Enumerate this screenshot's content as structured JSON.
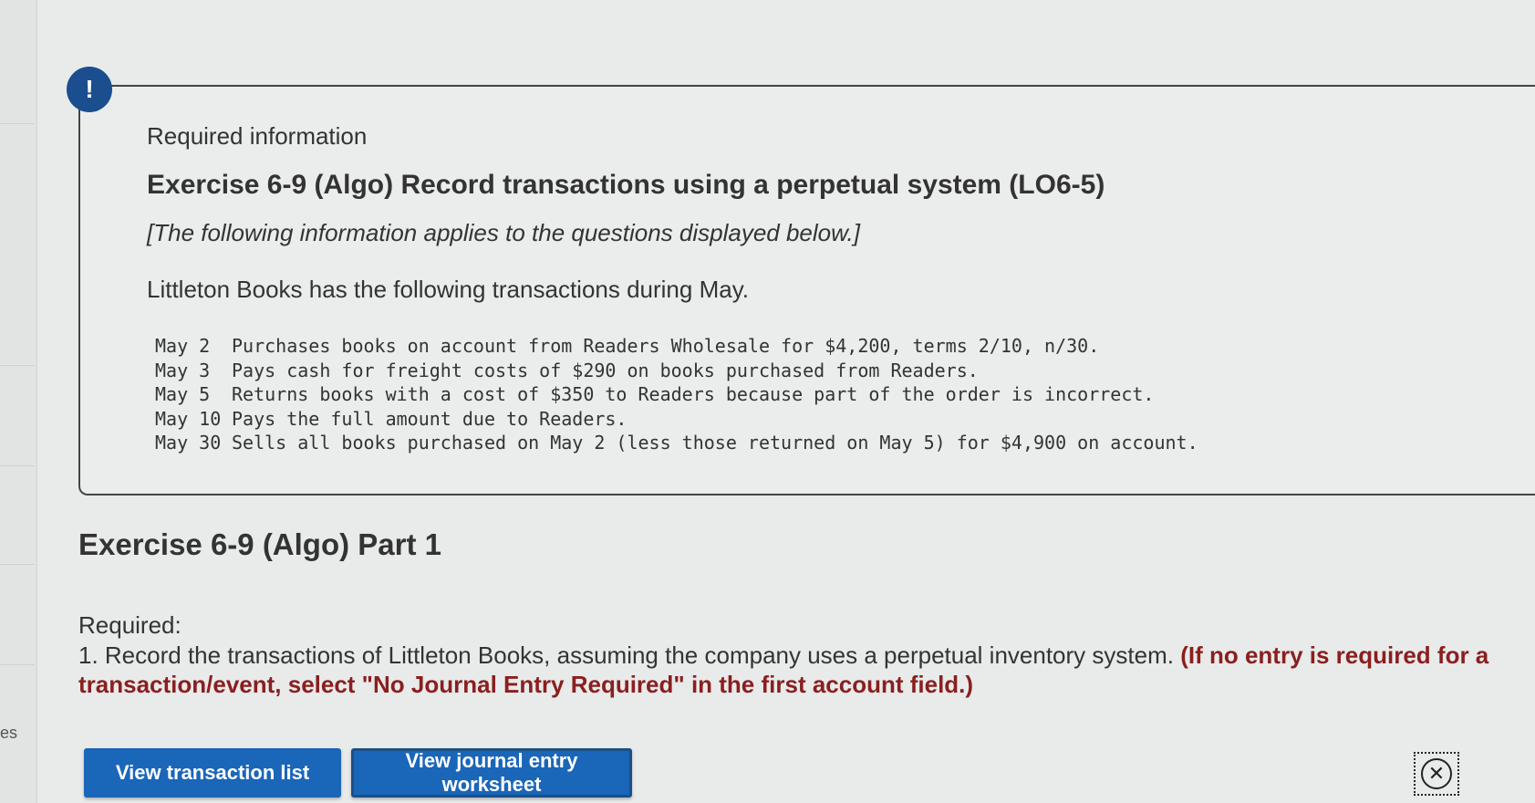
{
  "side_label": "es",
  "info": {
    "alert_symbol": "!",
    "required_information": "Required information",
    "exercise_title": "Exercise 6-9 (Algo) Record transactions using a perpetual system (LO6-5)",
    "subtitle": "[The following information applies to the questions displayed below.]",
    "intro": "Littleton Books has the following transactions during May.",
    "transactions": [
      {
        "date": "May 2",
        "text": "Purchases books on account from Readers Wholesale for $4,200, terms 2/10, n/30."
      },
      {
        "date": "May 3",
        "text": "Pays cash for freight costs of $290 on books purchased from Readers."
      },
      {
        "date": "May 5",
        "text": "Returns books with a cost of $350 to Readers because part of the order is incorrect."
      },
      {
        "date": "May 10",
        "text": "Pays the full amount due to Readers."
      },
      {
        "date": "May 30",
        "text": "Sells all books purchased on May 2 (less those returned on May 5) for $4,900 on account."
      }
    ]
  },
  "part": {
    "title": "Exercise 6-9 (Algo) Part 1",
    "required_label": "Required:",
    "required_text": "1. Record the transactions of Littleton Books, assuming the company uses a perpetual inventory system.",
    "required_instruction": "(If no entry is required for a transaction/event, select \"No Journal Entry Required\" in the first account field.)"
  },
  "buttons": {
    "view_transaction_list": "View transaction list",
    "view_journal_entry_worksheet": "View journal entry worksheet"
  },
  "icons": {
    "close": "close-circle-icon"
  },
  "colors": {
    "accent": "#1a66b8",
    "alert": "#1a4e8f",
    "instruction": "#8a1f1f"
  }
}
